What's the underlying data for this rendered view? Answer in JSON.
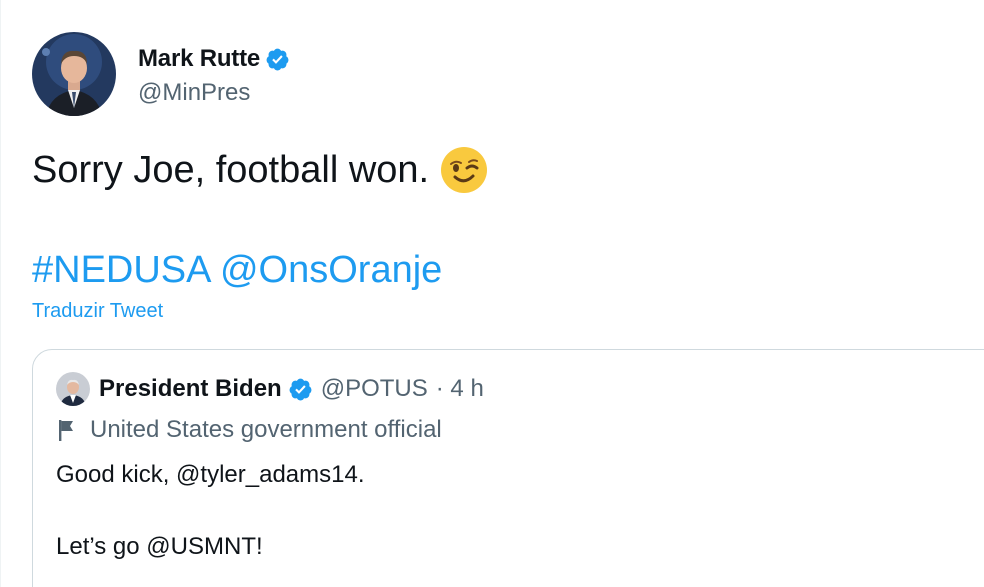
{
  "tweet": {
    "author": {
      "name": "Mark Rutte",
      "handle": "@MinPres"
    },
    "text": "Sorry Joe, football won.",
    "emoji": "winking-face-icon",
    "hashtag": "#NEDUSA",
    "mention": "@OnsOranje",
    "translate_label": "Traduzir Tweet"
  },
  "quoted_tweet": {
    "author": {
      "name": "President Biden",
      "handle": "@POTUS",
      "meta": "· 4 h"
    },
    "label": "United States government official",
    "line1": "Good kick, @tyler_adams14.",
    "line2": "Let’s go @USMNT!"
  },
  "colors": {
    "link": "#1d9bf0",
    "verified": "#1d9bf0",
    "secondary_text": "#536471",
    "border": "#cfd9de"
  }
}
